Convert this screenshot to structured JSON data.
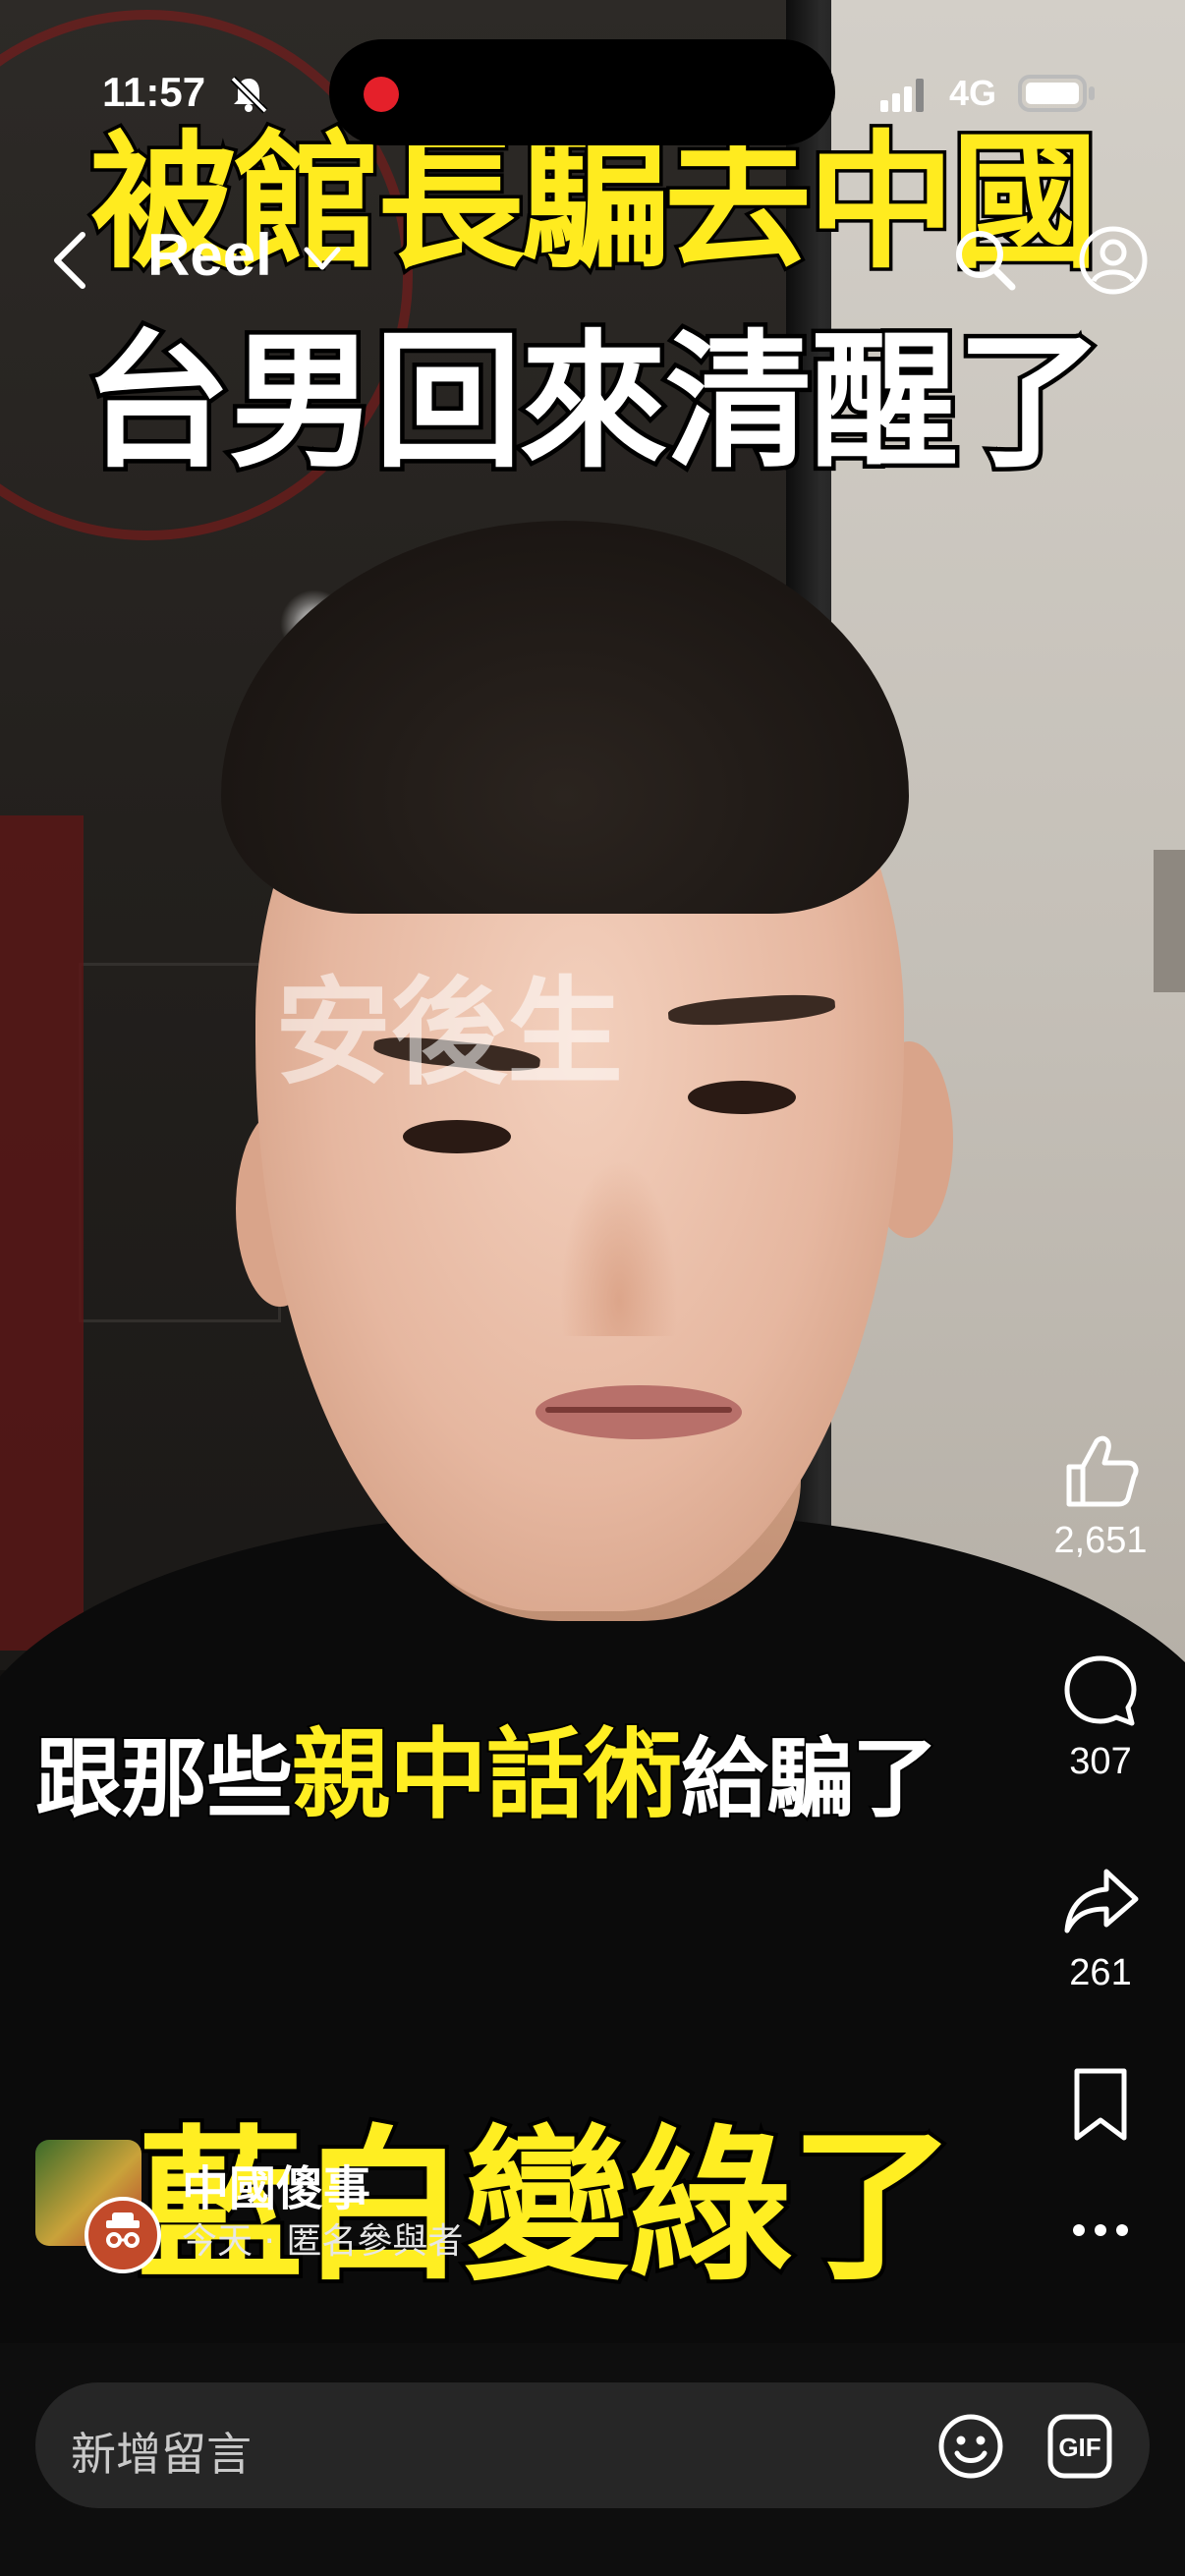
{
  "status_bar": {
    "time": "11:57",
    "network": "4G",
    "icons": [
      "bell-muted-icon",
      "signal-icon",
      "battery-icon"
    ]
  },
  "header": {
    "title": "Reel",
    "icons": [
      "back-icon",
      "chevron-down-icon",
      "search-icon",
      "profile-icon"
    ]
  },
  "video": {
    "title_line1": "被館長騙去中國",
    "title_line2": "台男回來清醒了",
    "watermark": "安後生",
    "subtitle_prefix": "跟那些",
    "subtitle_highlight": "親中話術",
    "subtitle_suffix": "給騙了",
    "subtitle_big": "藍白變綠了"
  },
  "actions": {
    "likes": "2,651",
    "comments": "307",
    "shares": "261",
    "icons": [
      "like-icon",
      "comment-icon",
      "share-icon",
      "bookmark-icon",
      "more-icon"
    ]
  },
  "author": {
    "name": "中國傻事",
    "meta": "今天 · 匿名參與者"
  },
  "comment_bar": {
    "placeholder": "新增留言",
    "icons": [
      "emoji-icon",
      "gif-icon"
    ]
  },
  "colors": {
    "title_yellow": "#ffeb1f",
    "recording_red": "#e5202a",
    "background": "#000000"
  }
}
